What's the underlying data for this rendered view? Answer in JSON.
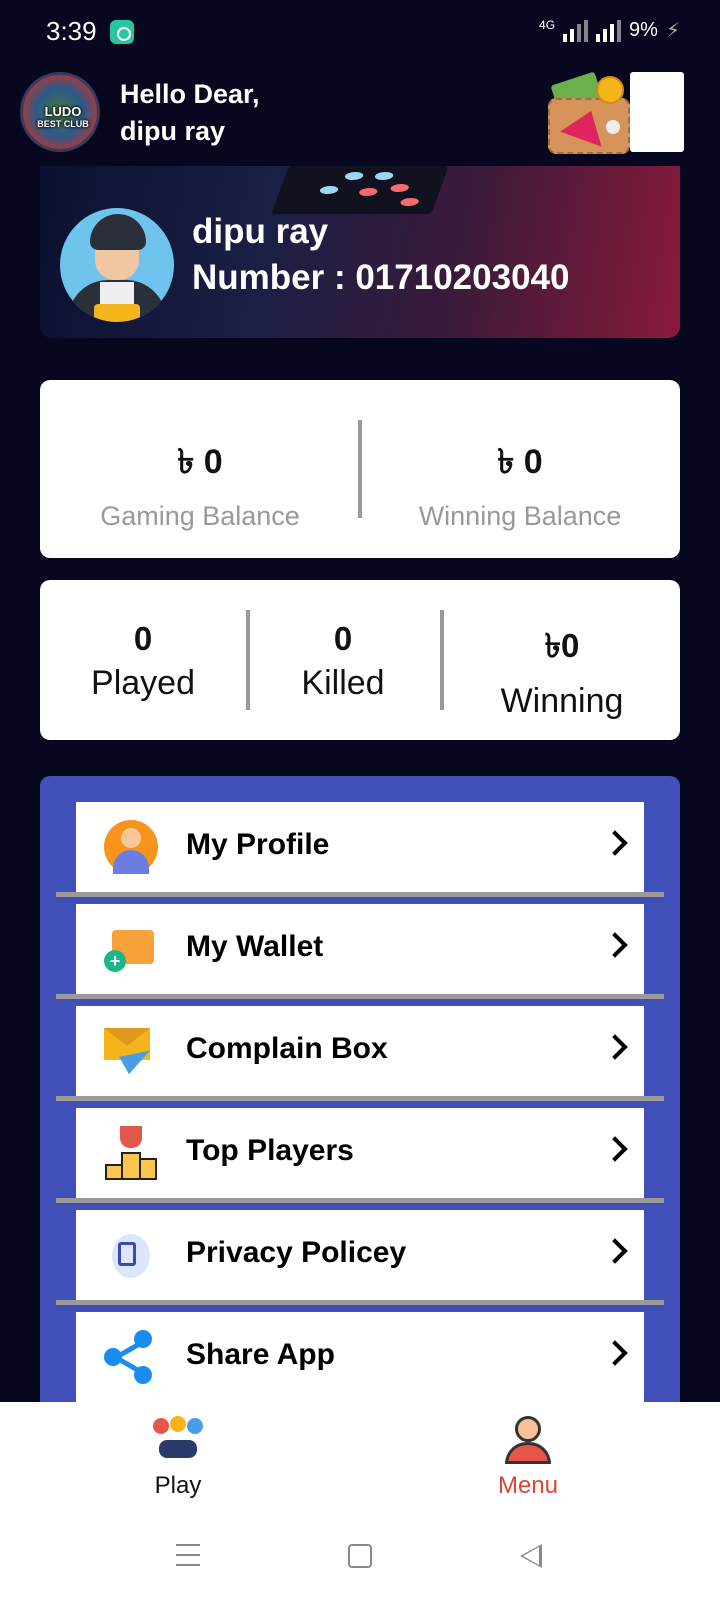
{
  "status_bar": {
    "time": "3:39",
    "network": "4G",
    "battery": "9%"
  },
  "header": {
    "logo_text": "LUDO",
    "logo_subtext": "BEST CLUB",
    "greeting_line1": "Hello Dear,",
    "greeting_line2": "dipu ray"
  },
  "profile": {
    "name": "dipu ray",
    "number": "Number : 01710203040"
  },
  "balances": {
    "gaming_value": "৳ 0",
    "gaming_label": "Gaming Balance",
    "winning_value": "৳ 0",
    "winning_label": "Winning Balance"
  },
  "stats": {
    "played_value": "0",
    "played_label": "Played",
    "killed_value": "0",
    "killed_label": "Killed",
    "winning_value": "৳0",
    "winning_label": "Winning"
  },
  "menu": {
    "items": [
      {
        "label": "My Profile",
        "icon": "profile-icon"
      },
      {
        "label": "My Wallet",
        "icon": "wallet-add-icon"
      },
      {
        "label": "Complain Box",
        "icon": "mail-plane-icon"
      },
      {
        "label": "Top Players",
        "icon": "trophy-podium-icon"
      },
      {
        "label": "Privacy Policey",
        "icon": "privacy-document-icon"
      },
      {
        "label": "Share App",
        "icon": "share-icon"
      }
    ]
  },
  "bottom_nav": {
    "play_label": "Play",
    "menu_label": "Menu",
    "active_color": "#e0453a"
  },
  "colors": {
    "background": "#07071f",
    "menu_panel": "#4150b8"
  }
}
